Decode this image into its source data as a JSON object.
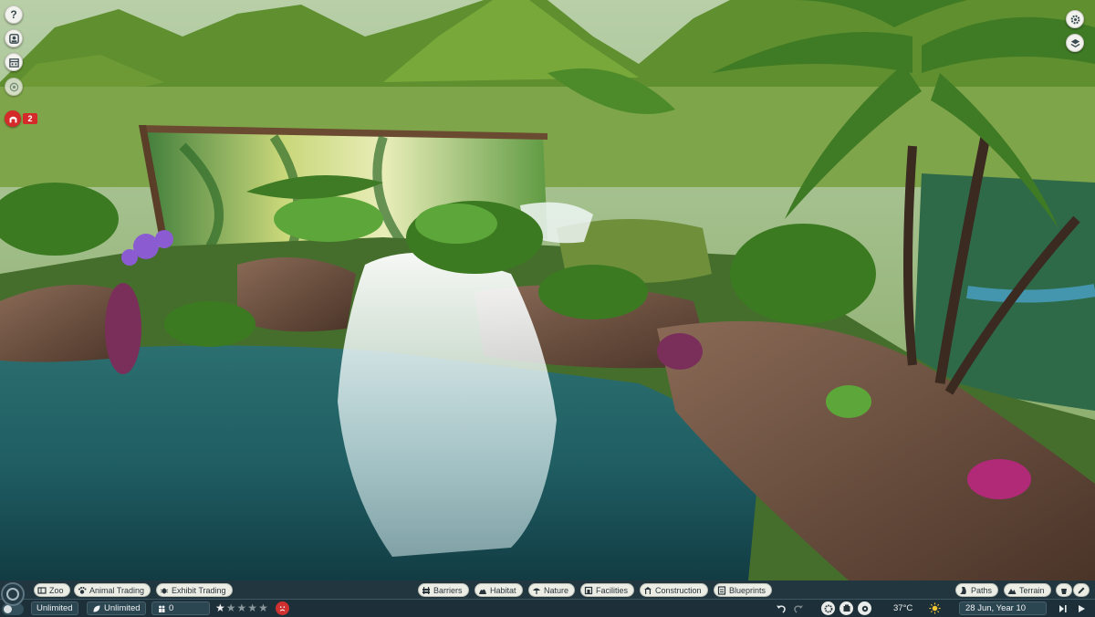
{
  "left_toolbar": {
    "help_label": "?",
    "icons": [
      "help-icon",
      "guest-icon",
      "calendar-icon",
      "camera-icon"
    ],
    "alert_count": "2"
  },
  "right_toolbar": {
    "icons": [
      "settings-icon",
      "layers-icon"
    ]
  },
  "hud": {
    "menu": [
      {
        "label": "Zoo",
        "icon": "zoo-icon"
      },
      {
        "label": "Animal Trading",
        "icon": "paw-icon"
      },
      {
        "label": "Exhibit Trading",
        "icon": "bug-icon"
      },
      {
        "label": "Barriers",
        "icon": "barrier-icon"
      },
      {
        "label": "Habitat",
        "icon": "habitat-icon"
      },
      {
        "label": "Nature",
        "icon": "tree-icon"
      },
      {
        "label": "Facilities",
        "icon": "facilities-icon"
      },
      {
        "label": "Construction",
        "icon": "construction-icon"
      },
      {
        "label": "Blueprints",
        "icon": "blueprint-icon"
      },
      {
        "label": "Paths",
        "icon": "path-icon"
      },
      {
        "label": "Terrain",
        "icon": "terrain-icon"
      }
    ],
    "status": {
      "money": "Unlimited",
      "conservation": "Unlimited",
      "guests": "0",
      "zoo_rating_stars": 1,
      "zoo_rating_max": 5
    },
    "weather": {
      "temperature": "37°C",
      "date": "28 Jun, Year 10"
    },
    "colors": {
      "hud_bar": "#223742",
      "button_bg": "#eceee6",
      "alert": "#d42a2a",
      "water": "#1f5e63"
    }
  }
}
